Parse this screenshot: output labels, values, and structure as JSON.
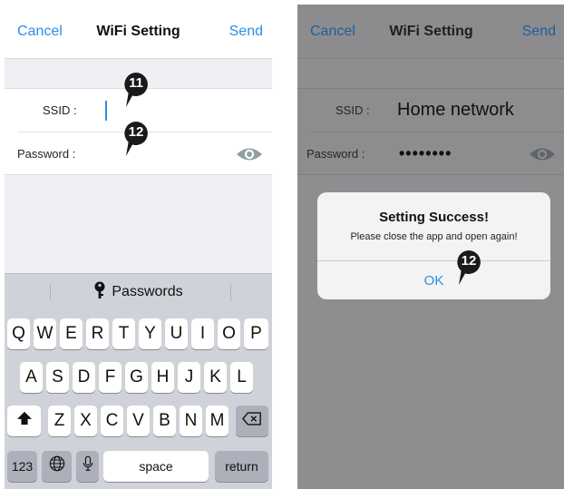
{
  "left": {
    "nav": {
      "cancel": "Cancel",
      "title": "WiFi Setting",
      "send": "Send"
    },
    "form": {
      "ssid_label": "SSID :",
      "ssid_value": "",
      "password_label": "Password :",
      "password_value": ""
    },
    "markers": [
      "11",
      "12"
    ],
    "keyboard": {
      "suggestion": "Passwords",
      "row1": [
        "Q",
        "W",
        "E",
        "R",
        "T",
        "Y",
        "U",
        "I",
        "O",
        "P"
      ],
      "row2": [
        "A",
        "S",
        "D",
        "F",
        "G",
        "H",
        "J",
        "K",
        "L"
      ],
      "row3": [
        "Z",
        "X",
        "C",
        "V",
        "B",
        "N",
        "M"
      ],
      "numbers_key": "123",
      "space_key": "space",
      "return_key": "return"
    }
  },
  "right": {
    "nav": {
      "cancel": "Cancel",
      "title": "WiFi Setting",
      "send": "Send"
    },
    "form": {
      "ssid_label": "SSID :",
      "ssid_value": "Home network",
      "password_label": "Password :",
      "password_value": "••••••••"
    },
    "dialog": {
      "title": "Setting Success!",
      "message": "Please close the app and open again!",
      "ok": "OK"
    },
    "marker": "12"
  },
  "colors": {
    "accent": "#2a8ee8",
    "marker": "#1a1a1a",
    "eye": "#8f9ea3"
  }
}
